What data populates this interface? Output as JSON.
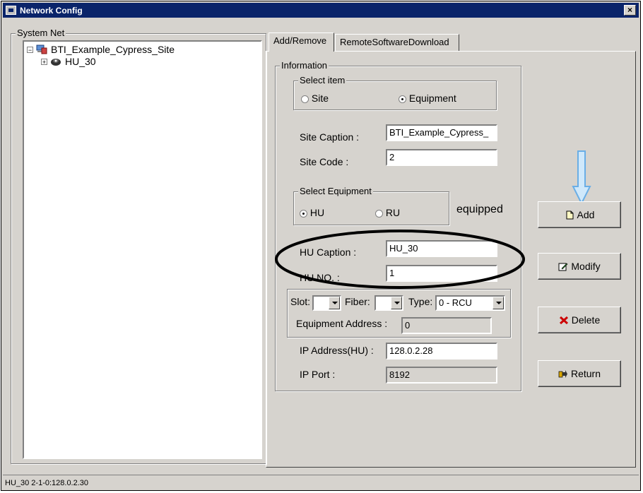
{
  "window": {
    "title": "Network Config",
    "close_label": "×"
  },
  "system_net": {
    "label": "System Net",
    "tree": [
      {
        "label": "BTI_Example_Cypress_Site",
        "expander": "−",
        "icon": "network-site-icon"
      },
      {
        "label": "HU_30",
        "expander": "+",
        "icon": "hub-unit-icon"
      }
    ]
  },
  "tabs": [
    {
      "label": "Add/Remove",
      "active": true
    },
    {
      "label": "RemoteSoftwareDownload",
      "active": false
    }
  ],
  "information": {
    "label": "Information",
    "select_item": {
      "label": "Select item",
      "options": [
        {
          "label": "Site",
          "selected": false
        },
        {
          "label": "Equipment",
          "selected": true
        }
      ]
    },
    "site_caption": {
      "label": "Site Caption :",
      "value": "BTI_Example_Cypress_"
    },
    "site_code": {
      "label": "Site Code :",
      "value": "2"
    },
    "select_equipment": {
      "label": "Select Equipment",
      "options": [
        {
          "label": "HU",
          "selected": true
        },
        {
          "label": "RU",
          "selected": false
        }
      ]
    },
    "equipped_label": "equipped",
    "hu_caption": {
      "label": "HU Caption :",
      "value": "HU_30"
    },
    "hu_no": {
      "label": "HU NO. :",
      "value": "1"
    },
    "slot": {
      "label": "Slot:",
      "value": ""
    },
    "fiber": {
      "label": "Fiber:",
      "value": ""
    },
    "type": {
      "label": "Type:",
      "value": "0 - RCU"
    },
    "equipment_address": {
      "label": "Equipment Address :",
      "value": "0"
    },
    "ip_address": {
      "label": "IP Address(HU) :",
      "value": "128.0.2.28"
    },
    "ip_port": {
      "label": "IP Port :",
      "value": "8192"
    }
  },
  "buttons": {
    "add": {
      "label": "Add",
      "icon": "add-document-icon"
    },
    "modify": {
      "label": "Modify",
      "icon": "edit-icon"
    },
    "delete": {
      "label": "Delete",
      "icon": "delete-x-icon"
    },
    "return": {
      "label": "Return",
      "icon": "return-icon"
    }
  },
  "status_bar": {
    "text": "HU_30 2-1-0:128.0.2.30"
  },
  "colors": {
    "titlebar": "#0a246a",
    "face": "#d6d3ce",
    "annotation_arrow": "#a9d4f5",
    "delete_icon": "#cc0000"
  }
}
